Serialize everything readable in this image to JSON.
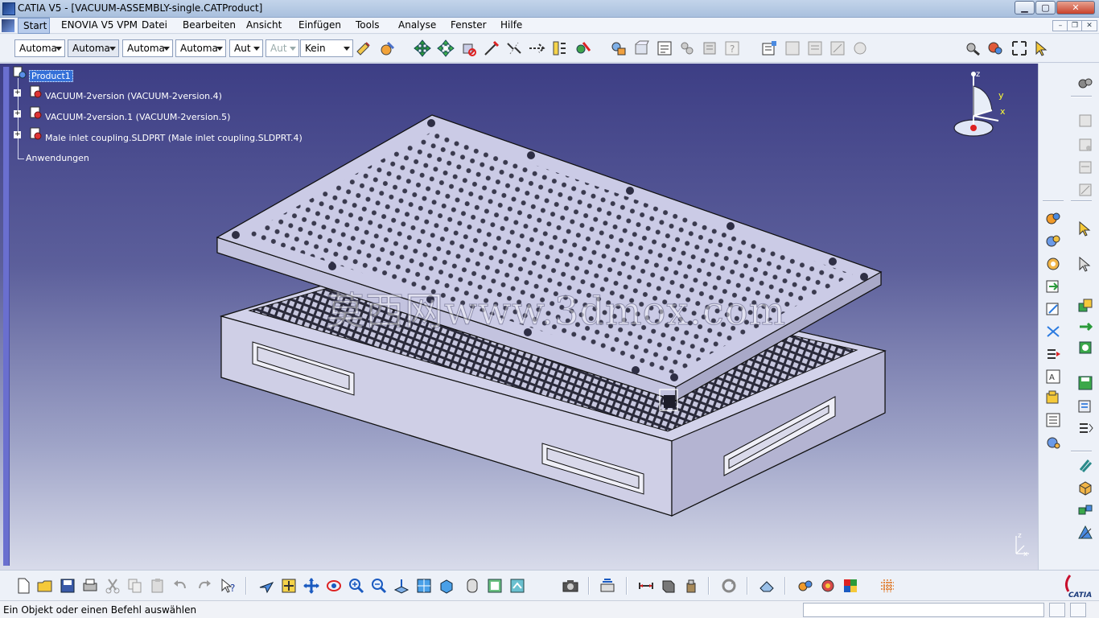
{
  "window": {
    "title": "CATIA V5 - [VACUUM-ASSEMBLY-single.CATProduct]",
    "minimize": "▁",
    "maximize": "▢",
    "close": "✕"
  },
  "menu": {
    "items": [
      "Start",
      "ENOVIA V5 VPM",
      "Datei",
      "Bearbeiten",
      "Ansicht",
      "Einfügen",
      "Tools",
      "Analyse",
      "Fenster",
      "Hilfe"
    ],
    "mdi_minimize": "–",
    "mdi_restore": "❐",
    "mdi_close": "✕"
  },
  "toolbar_top": {
    "combos": [
      {
        "value": "Automa",
        "state": "normal"
      },
      {
        "value": "Automa",
        "state": "selected"
      },
      {
        "value": "Automa",
        "state": "normal"
      },
      {
        "value": "Automa",
        "state": "normal"
      },
      {
        "value": "Aut",
        "state": "normal"
      },
      {
        "value": "Aut",
        "state": "disabled"
      },
      {
        "value": "Kein",
        "state": "normal"
      }
    ]
  },
  "tree": {
    "root": "Product1",
    "children": [
      "VACUUM-2version (VACUUM-2version.4)",
      "VACUUM-2version.1 (VACUUM-2version.5)",
      "Male inlet coupling.SLDPRT (Male inlet coupling.SLDPRT.4)"
    ],
    "applications": "Anwendungen"
  },
  "viewport": {
    "watermark": "莫西网www.3dmox.com",
    "compass_axes": {
      "z": "z",
      "y": "y",
      "x": "x"
    },
    "axis_tag_axes": {
      "z": "z",
      "x": "x"
    },
    "colors": {
      "bg_top": "#3d3e85",
      "bg_bottom": "#d8dbea",
      "part_face": "#cbcbe6",
      "part_edge": "#1a1a2a"
    }
  },
  "status": {
    "text": "Ein Objekt oder einen Befehl auswählen"
  },
  "logo": {
    "text": "CATIA"
  }
}
